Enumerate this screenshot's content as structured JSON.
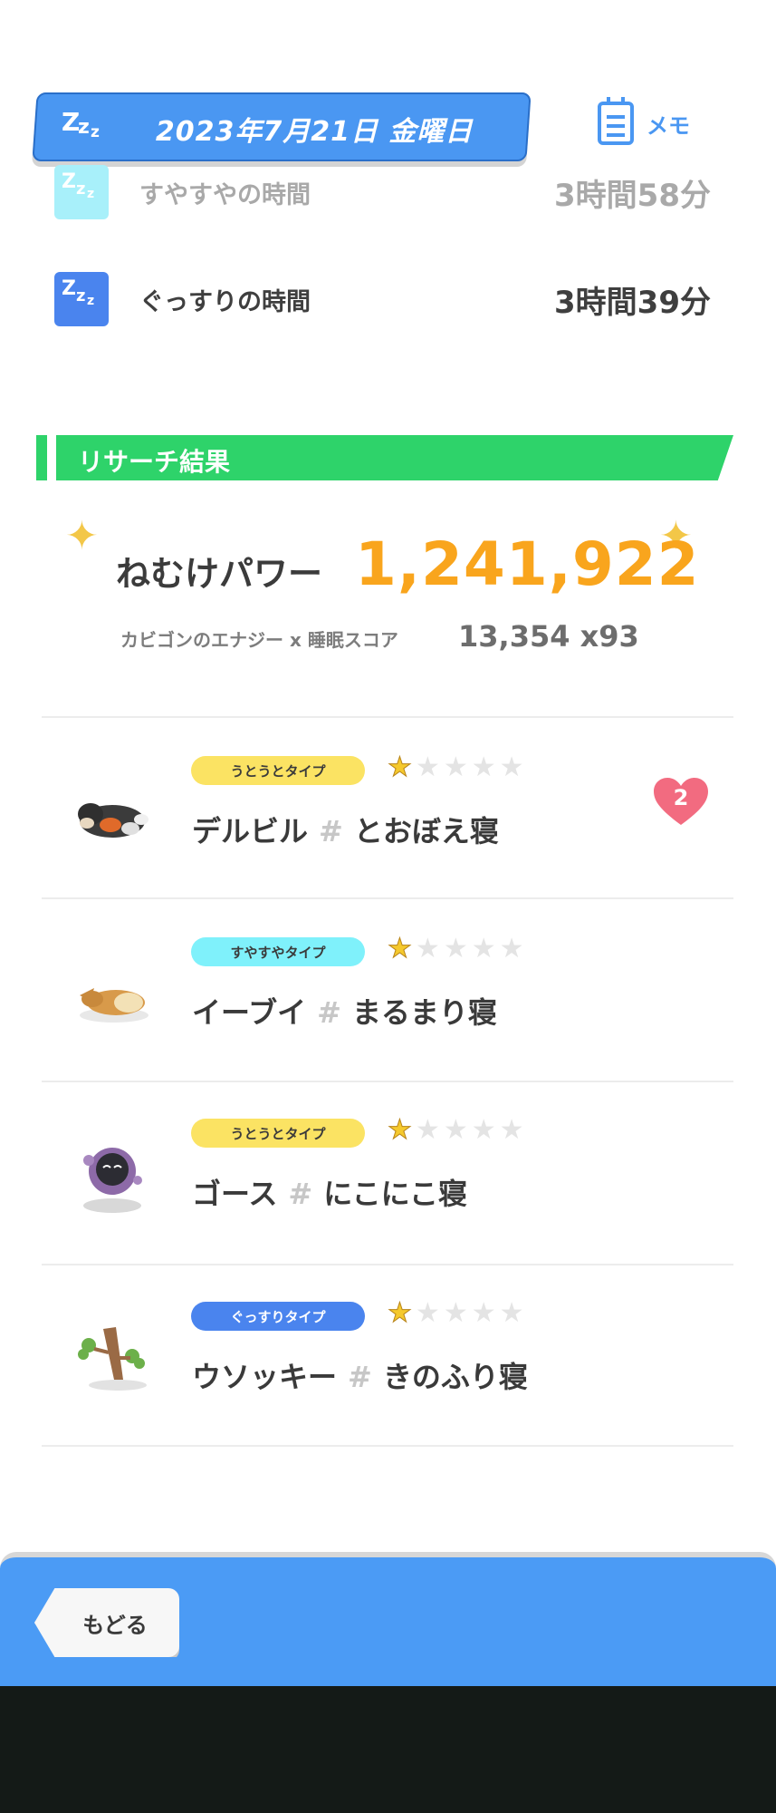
{
  "header": {
    "date": "2023年7月21日 金曜日",
    "memo_label": "メモ"
  },
  "sleep": [
    {
      "label": "すやすやの時間",
      "value": "3時間58分"
    },
    {
      "label": "ぐっすりの時間",
      "value": "3時間39分"
    }
  ],
  "research": {
    "title": "リサーチ結果",
    "power_label": "ねむけパワー",
    "power_value": "1,241,922",
    "formula_label": "カビゴンのエナジー x 睡眠スコア",
    "formula_value": "13,354 x93"
  },
  "pokemon": [
    {
      "type": "うとうとタイプ",
      "type_color": "#fbe363",
      "stars": 1,
      "name": "デルビル",
      "style": "とおぼえ寝",
      "heart": "2"
    },
    {
      "type": "すやすやタイプ",
      "type_color": "#7ff1fb",
      "stars": 1,
      "name": "イーブイ",
      "style": "まるまり寝"
    },
    {
      "type": "うとうとタイプ",
      "type_color": "#fbe363",
      "stars": 1,
      "name": "ゴース",
      "style": "にこにこ寝"
    },
    {
      "type": "ぐっすりタイプ",
      "type_color": "#4a84ee",
      "stars": 1,
      "name": "ウソッキー",
      "style": "きのふり寝"
    }
  ],
  "footer": {
    "back_label": "もどる"
  },
  "icons": [
    "zzz-icon",
    "memo-icon",
    "sparkle-icon",
    "star-icon",
    "heart-icon"
  ]
}
